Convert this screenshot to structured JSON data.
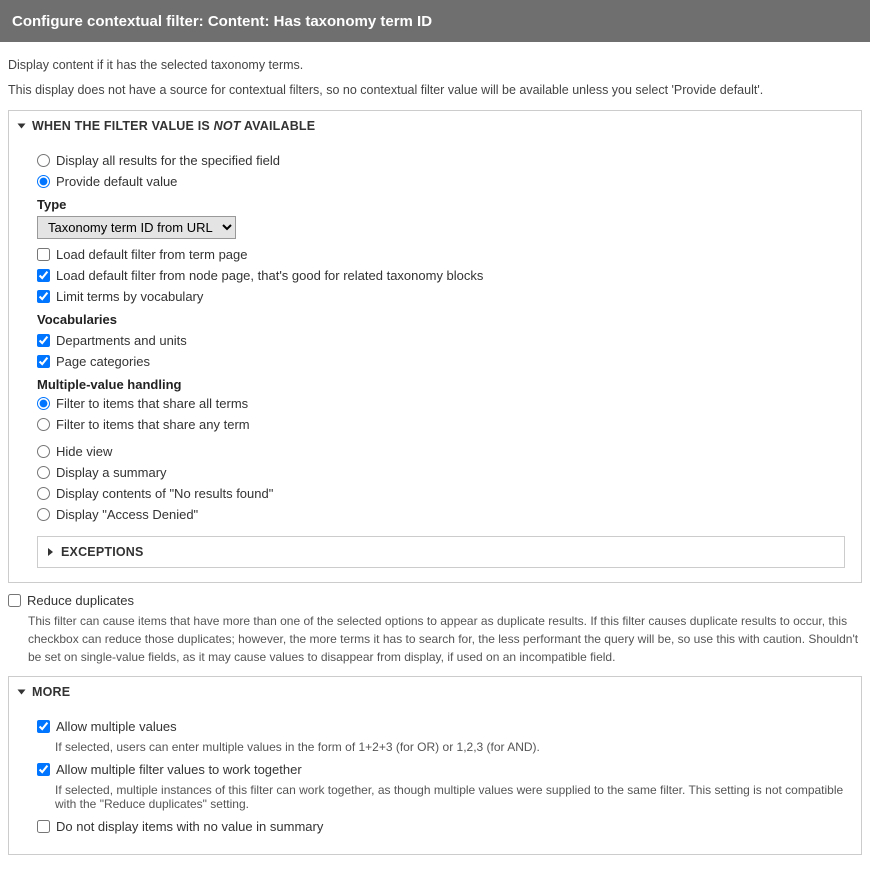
{
  "header": {
    "title": "Configure contextual filter: Content: Has taxonomy term ID"
  },
  "intro": {
    "line1": "Display content if it has the selected taxonomy terms.",
    "line2": "This display does not have a source for contextual filters, so no contextual filter value will be available unless you select 'Provide default'."
  },
  "notAvailable": {
    "legendPrefix": "When the filter value is ",
    "legendEm": "not",
    "legendSuffix": " available",
    "radios": {
      "displayAll": "Display all results for the specified field",
      "provideDefault": "Provide default value",
      "hideView": "Hide view",
      "displaySummary": "Display a summary",
      "displayNoResults": "Display contents of \"No results found\"",
      "displayAccessDenied": "Display \"Access Denied\""
    },
    "typeLabel": "Type",
    "typeSelect": "Taxonomy term ID from URL",
    "checkboxes": {
      "loadFromTerm": "Load default filter from term page",
      "loadFromNode": "Load default filter from node page, that's good for related taxonomy blocks",
      "limitVocab": "Limit terms by vocabulary"
    },
    "vocabLabel": "Vocabularies",
    "vocabOptions": {
      "dept": "Departments and units",
      "pageCat": "Page categories"
    },
    "multiLabel": "Multiple-value handling",
    "multiRadios": {
      "allTerms": "Filter to items that share all terms",
      "anyTerm": "Filter to items that share any term"
    },
    "exceptionsLegend": "Exceptions"
  },
  "reduceDup": {
    "label": "Reduce duplicates",
    "desc": "This filter can cause items that have more than one of the selected options to appear as duplicate results. If this filter causes duplicate results to occur, this checkbox can reduce those duplicates; however, the more terms it has to search for, the less performant the query will be, so use this with caution. Shouldn't be set on single-value fields, as it may cause values to disappear from display, if used on an incompatible field."
  },
  "more": {
    "legend": "More",
    "allowMulti": {
      "label": "Allow multiple values",
      "desc": "If selected, users can enter multiple values in the form of 1+2+3 (for OR) or 1,2,3 (for AND)."
    },
    "allowTogether": {
      "label": "Allow multiple filter values to work together",
      "desc": "If selected, multiple instances of this filter can work together, as though multiple values were supplied to the same filter. This setting is not compatible with the \"Reduce duplicates\" setting."
    },
    "noValue": {
      "label": "Do not display items with no value in summary"
    }
  }
}
